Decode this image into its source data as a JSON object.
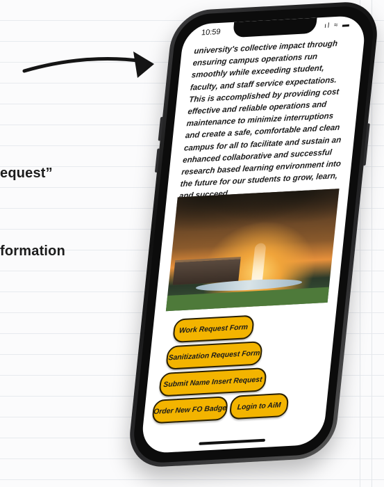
{
  "background": {
    "visible_fragments": {
      "line1": "equest”",
      "line2": "formation"
    }
  },
  "phone": {
    "status": {
      "time": "10:59",
      "icons": "ıl ≈ ▬"
    },
    "body_text": "university's collective impact through ensuring campus operations run smoothly while exceeding student, faculty, and staff service expectations. This is accomplished by providing cost effective and reliable operations and maintenance to minimize interruptions and create a safe, comfortable and clean campus for all to facilitate and sustain an enhanced collaborative and successful research based learning environment into the future for our students to grow, learn, and succeed.",
    "buttons": {
      "work_request": "Work Request Form",
      "sanitization_request": "Sanitization Request Form",
      "name_insert": "Submit Name Insert Request",
      "fo_badge": "Order New FO Badge",
      "login_aim": "Login to AiM"
    }
  },
  "colors": {
    "button_fill": "#f3b400",
    "button_border": "#2a2000"
  }
}
